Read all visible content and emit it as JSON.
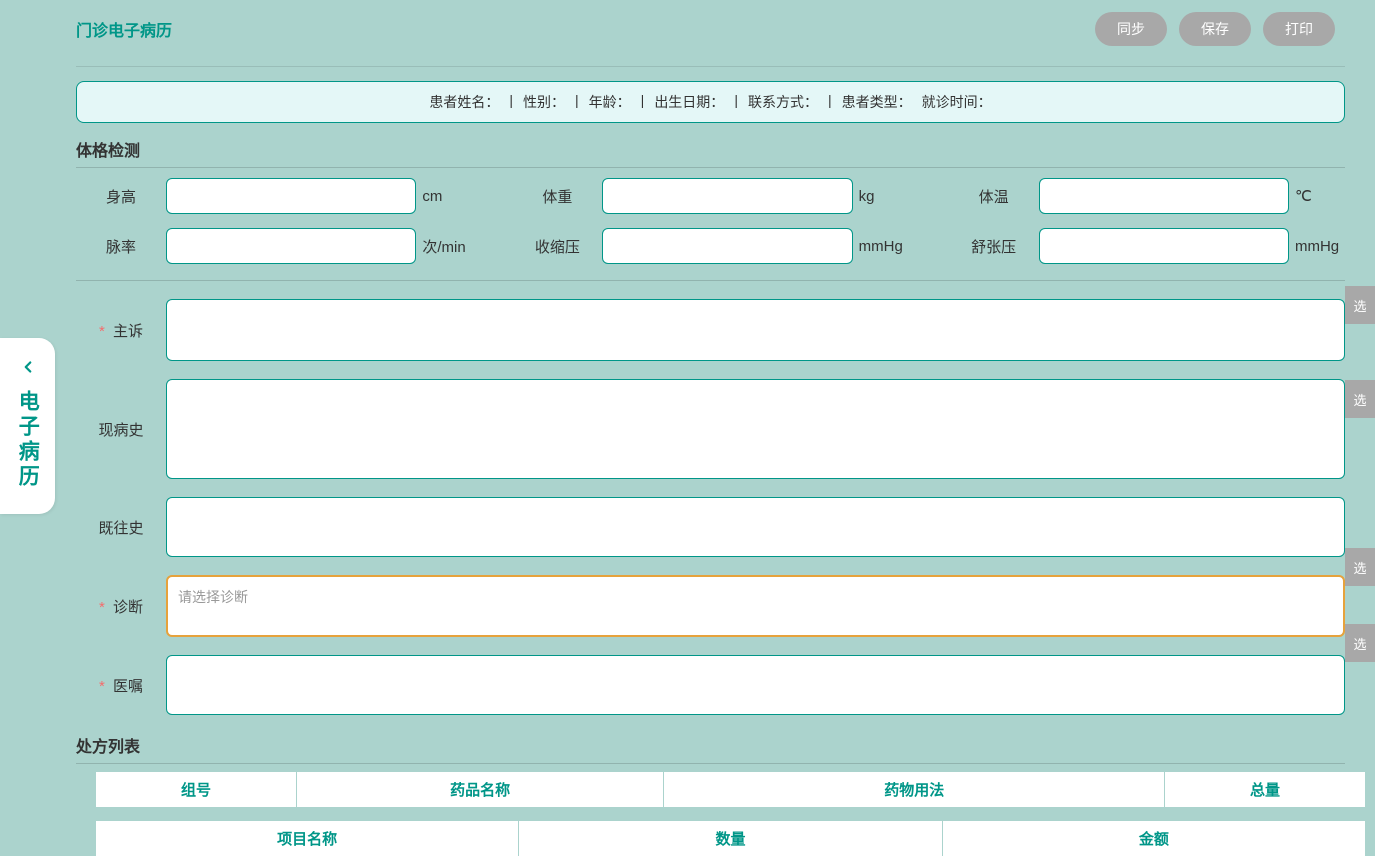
{
  "header": {
    "title": "门诊电子病历",
    "buttons": {
      "sync": "同步",
      "save": "保存",
      "print": "打印"
    }
  },
  "sideTab": {
    "text": "电子病历"
  },
  "patientInfo": {
    "name_label": "患者姓名：",
    "gender_label": "性别：",
    "age_label": "年龄：",
    "birth_label": "出生日期：",
    "contact_label": "联系方式：",
    "type_label": "患者类型：",
    "visit_time_label": "就诊时间：",
    "separator": "|"
  },
  "sections": {
    "vitals_title": "体格检测",
    "prescription_title": "处方列表"
  },
  "vitals": {
    "height": {
      "label": "身高",
      "unit": "cm"
    },
    "weight": {
      "label": "体重",
      "unit": "kg"
    },
    "temp": {
      "label": "体温",
      "unit": "℃"
    },
    "pulse": {
      "label": "脉率",
      "unit": "次/min"
    },
    "systolic": {
      "label": "收缩压",
      "unit": "mmHg"
    },
    "diastolic": {
      "label": "舒张压",
      "unit": "mmHg"
    }
  },
  "textFields": {
    "chief_complaint": {
      "label": "主诉",
      "required": true
    },
    "present_illness": {
      "label": "现病史",
      "required": false
    },
    "past_history": {
      "label": "既往史",
      "required": false
    },
    "diagnosis": {
      "label": "诊断",
      "required": true,
      "placeholder": "请选择诊断"
    },
    "advice": {
      "label": "医嘱",
      "required": true
    }
  },
  "common": {
    "select_btn": "选",
    "required_star": "*"
  },
  "prescriptionTable": {
    "headers": {
      "group": "组号",
      "drug_name": "药品名称",
      "usage": "药物用法",
      "total": "总量"
    }
  },
  "itemsTable": {
    "headers": {
      "item_name": "项目名称",
      "quantity": "数量",
      "amount": "金额"
    }
  }
}
